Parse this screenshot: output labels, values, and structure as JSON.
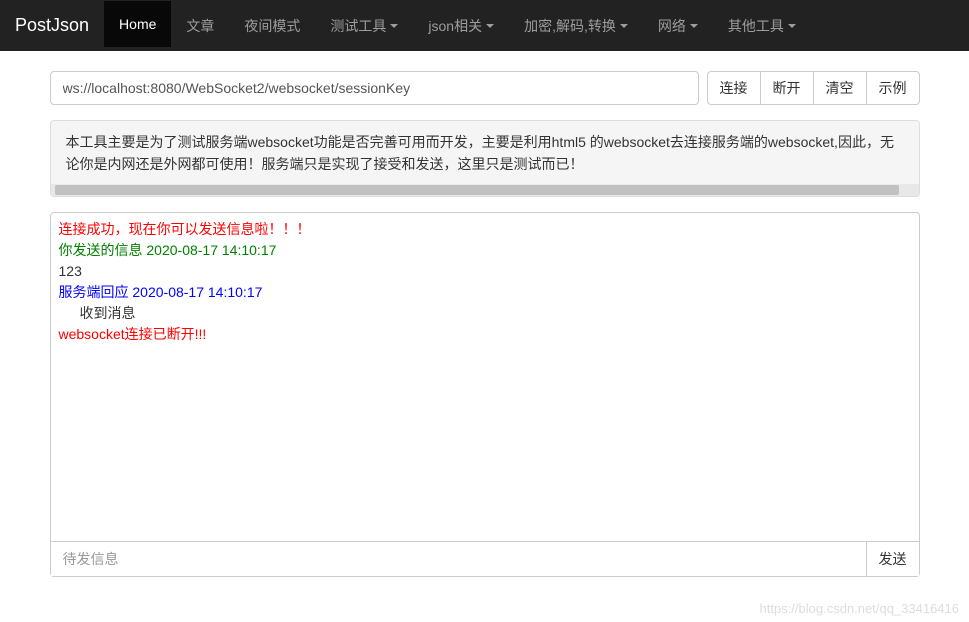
{
  "navbar": {
    "brand": "PostJson",
    "items": [
      {
        "label": "Home",
        "active": true,
        "dropdown": false
      },
      {
        "label": "文章",
        "active": false,
        "dropdown": false
      },
      {
        "label": "夜间模式",
        "active": false,
        "dropdown": false
      },
      {
        "label": "测试工具",
        "active": false,
        "dropdown": true
      },
      {
        "label": "json相关",
        "active": false,
        "dropdown": true
      },
      {
        "label": "加密,解码,转换",
        "active": false,
        "dropdown": true
      },
      {
        "label": "网络",
        "active": false,
        "dropdown": true
      },
      {
        "label": "其他工具",
        "active": false,
        "dropdown": true
      }
    ]
  },
  "url_input": {
    "value": "ws://localhost:8080/WebSocket2/websocket/sessionKey"
  },
  "buttons": {
    "connect": "连接",
    "disconnect": "断开",
    "clear": "清空",
    "example": "示例"
  },
  "info_panel": {
    "text": "本工具主要是为了测试服务端websocket功能是否完善可用而开发，主要是利用html5 的websocket去连接服务端的websocket,因此，无论你是内网还是外网都可使用！服务端只是实现了接受和发送，这里只是测试而已！"
  },
  "log": {
    "lines": [
      {
        "text": "连接成功，现在你可以发送信息啦！！！",
        "cls": "log-red"
      },
      {
        "text": "你发送的信息 2020-08-17 14:10:17",
        "cls": "log-green"
      },
      {
        "text": "123",
        "cls": "log-plain"
      },
      {
        "text": "服务端回应 2020-08-17 14:10:17",
        "cls": "log-blue"
      },
      {
        "text": "收到消息",
        "cls": "log-plain log-indent"
      },
      {
        "text": "websocket连接已断开!!!",
        "cls": "log-red"
      }
    ]
  },
  "send": {
    "placeholder": "待发信息",
    "button": "发送"
  },
  "watermark": "https://blog.csdn.net/qq_33416416"
}
